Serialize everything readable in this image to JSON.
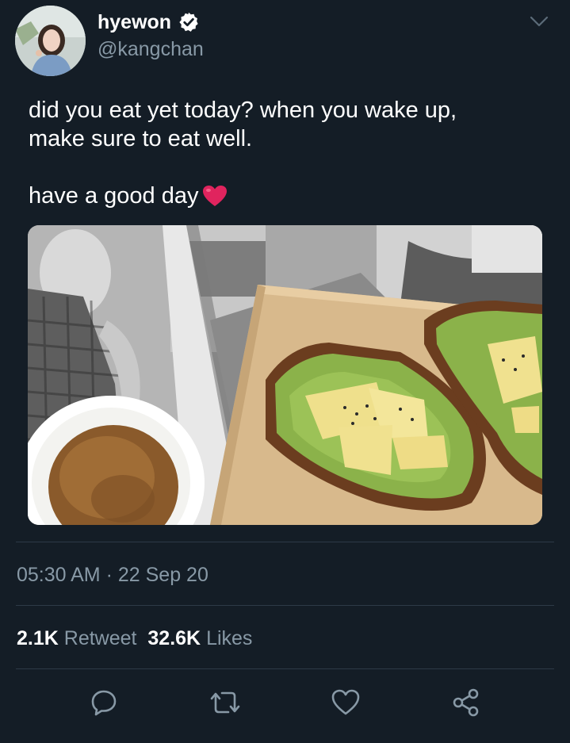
{
  "user": {
    "display_name": "hyewon",
    "handle": "@kangchan",
    "verified": true
  },
  "tweet": {
    "line1": "did you eat yet today? when you wake up,",
    "line2": "make sure to eat well.",
    "line3": "have a good day",
    "emoji": "heart-emoji"
  },
  "meta": {
    "time": "05:30 AM",
    "separator": "·",
    "date": "22 Sep 20"
  },
  "stats": {
    "retweets": "2.1K",
    "retweet_label": "Retweet",
    "likes": "32.6K",
    "likes_label": "Likes"
  },
  "actions": [
    "reply-icon",
    "retweet-icon",
    "like-icon",
    "share-icon"
  ],
  "colors": {
    "background": "#141d26",
    "muted": "#8899a6",
    "divider": "#2d3a47",
    "heart": "#e0245e"
  }
}
